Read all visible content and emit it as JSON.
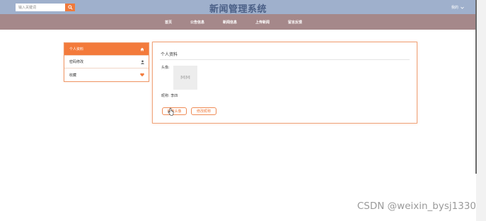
{
  "header": {
    "search_placeholder": "输入关键词",
    "site_title": "新闻管理系统",
    "user_label": "我的"
  },
  "nav": {
    "items": [
      "首页",
      "公告信息",
      "新闻信息",
      "上传新闻",
      "留言反馈"
    ]
  },
  "sidebar": {
    "items": [
      {
        "label": "个人资料",
        "icon": "home-icon"
      },
      {
        "label": "密码修改",
        "icon": "user-icon"
      },
      {
        "label": "收藏",
        "icon": "heart-icon"
      }
    ]
  },
  "profile": {
    "title": "个人资料",
    "avatar_label": "头像:",
    "avatar_text": "MM",
    "nickname_label": "昵称:",
    "nickname_value": "李四",
    "change_avatar_button": "修改头像",
    "change_nickname_button": "修改昵称"
  },
  "watermark": "CSDN @weixin_bysj1330",
  "colors": {
    "accent": "#f37a3b",
    "topbar": "#9fb0cc",
    "navbar": "#a5888a",
    "title": "#4a5f86"
  }
}
